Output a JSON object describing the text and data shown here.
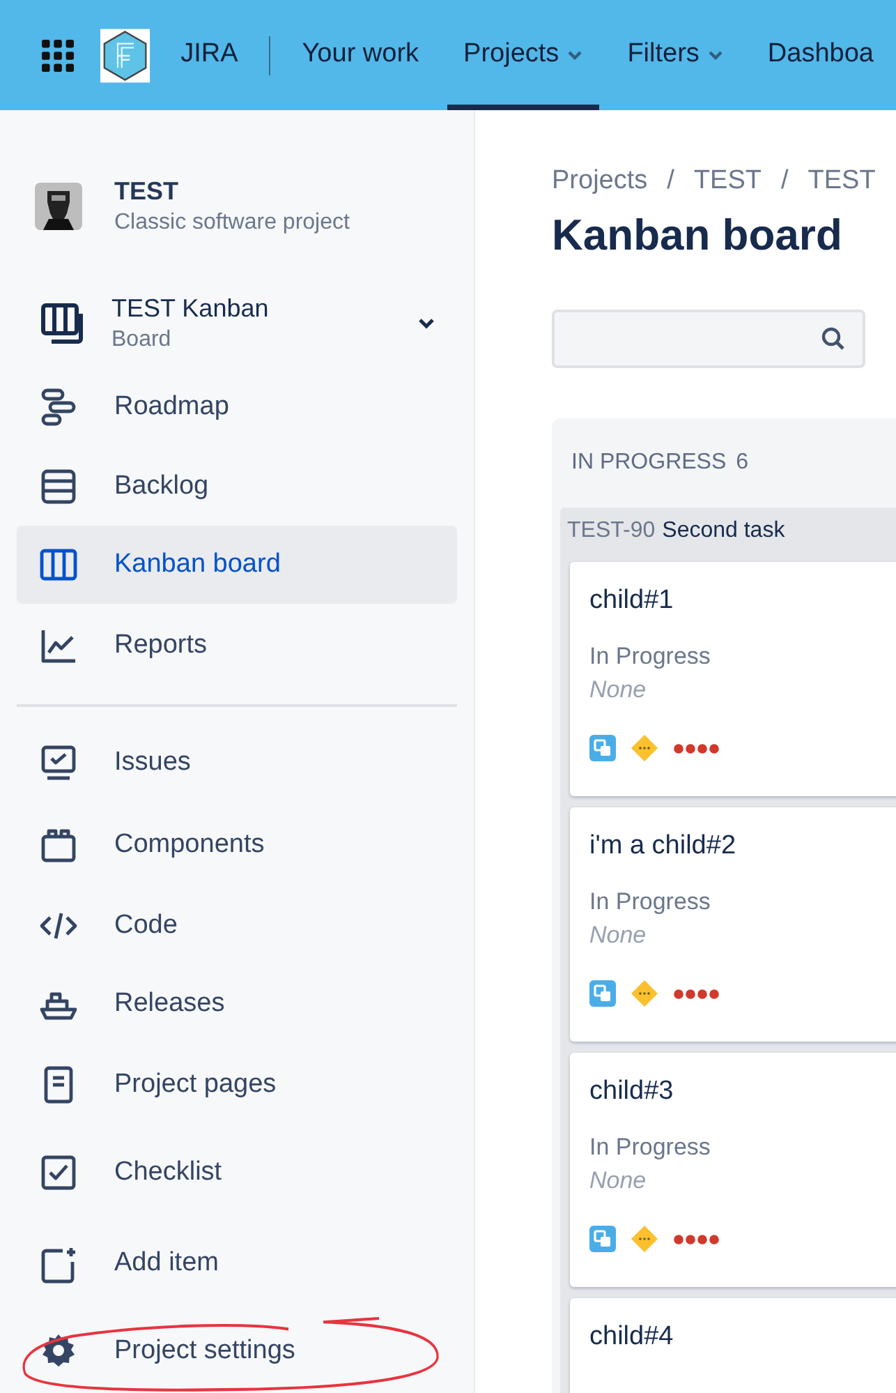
{
  "top_nav": {
    "product": "JIRA",
    "items": [
      {
        "label": "Your work",
        "dropdown": false,
        "selected": false
      },
      {
        "label": "Projects",
        "dropdown": true,
        "selected": true
      },
      {
        "label": "Filters",
        "dropdown": true,
        "selected": false
      },
      {
        "label": "Dashboa",
        "dropdown": false,
        "selected": false
      }
    ]
  },
  "sidebar": {
    "project": {
      "name": "TEST",
      "type": "Classic software project"
    },
    "board": {
      "name": "TEST Kanban",
      "type": "Board"
    },
    "items": [
      {
        "label": "Roadmap",
        "selected": false
      },
      {
        "label": "Backlog",
        "selected": false
      },
      {
        "label": "Kanban board",
        "selected": true
      },
      {
        "label": "Reports",
        "selected": false
      }
    ],
    "more_items": [
      {
        "label": "Issues",
        "selected": false
      },
      {
        "label": "Components",
        "selected": false
      },
      {
        "label": "Code",
        "selected": false
      },
      {
        "label": "Releases",
        "selected": false
      },
      {
        "label": "Project pages",
        "selected": false
      },
      {
        "label": "Checklist",
        "selected": false
      },
      {
        "label": "Add item",
        "selected": false
      },
      {
        "label": "Project settings",
        "selected": false
      }
    ]
  },
  "breadcrumb_separator": "/",
  "breadcrumbs": [
    "Projects",
    "TEST",
    "TEST"
  ],
  "title": "Kanban board",
  "column": {
    "name": "IN PROGRESS",
    "count": "6",
    "swimlane": {
      "key": "TEST-90",
      "summary": "Second task"
    },
    "cards": [
      {
        "title": "child#1",
        "status": "In Progress",
        "value": "None"
      },
      {
        "title": "i'm a child#2",
        "status": "In Progress",
        "value": "None"
      },
      {
        "title": "child#3",
        "status": "In Progress",
        "value": "None"
      },
      {
        "title": "child#4"
      }
    ]
  }
}
